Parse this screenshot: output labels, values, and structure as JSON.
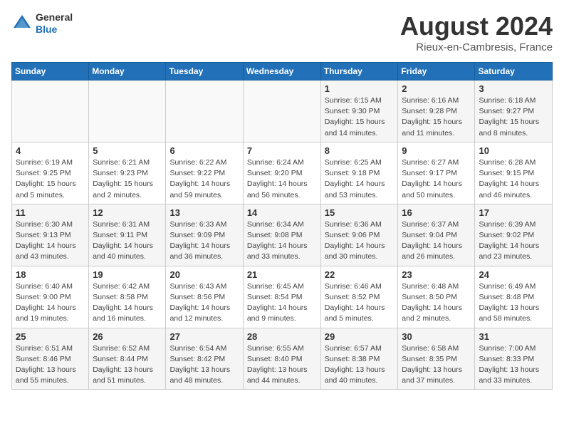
{
  "header": {
    "logo_general": "General",
    "logo_blue": "Blue",
    "month_year": "August 2024",
    "location": "Rieux-en-Cambresis, France"
  },
  "days_of_week": [
    "Sunday",
    "Monday",
    "Tuesday",
    "Wednesday",
    "Thursday",
    "Friday",
    "Saturday"
  ],
  "weeks": [
    [
      {
        "day": "",
        "info": ""
      },
      {
        "day": "",
        "info": ""
      },
      {
        "day": "",
        "info": ""
      },
      {
        "day": "",
        "info": ""
      },
      {
        "day": "1",
        "info": "Sunrise: 6:15 AM\nSunset: 9:30 PM\nDaylight: 15 hours\nand 14 minutes."
      },
      {
        "day": "2",
        "info": "Sunrise: 6:16 AM\nSunset: 9:28 PM\nDaylight: 15 hours\nand 11 minutes."
      },
      {
        "day": "3",
        "info": "Sunrise: 6:18 AM\nSunset: 9:27 PM\nDaylight: 15 hours\nand 8 minutes."
      }
    ],
    [
      {
        "day": "4",
        "info": "Sunrise: 6:19 AM\nSunset: 9:25 PM\nDaylight: 15 hours\nand 5 minutes."
      },
      {
        "day": "5",
        "info": "Sunrise: 6:21 AM\nSunset: 9:23 PM\nDaylight: 15 hours\nand 2 minutes."
      },
      {
        "day": "6",
        "info": "Sunrise: 6:22 AM\nSunset: 9:22 PM\nDaylight: 14 hours\nand 59 minutes."
      },
      {
        "day": "7",
        "info": "Sunrise: 6:24 AM\nSunset: 9:20 PM\nDaylight: 14 hours\nand 56 minutes."
      },
      {
        "day": "8",
        "info": "Sunrise: 6:25 AM\nSunset: 9:18 PM\nDaylight: 14 hours\nand 53 minutes."
      },
      {
        "day": "9",
        "info": "Sunrise: 6:27 AM\nSunset: 9:17 PM\nDaylight: 14 hours\nand 50 minutes."
      },
      {
        "day": "10",
        "info": "Sunrise: 6:28 AM\nSunset: 9:15 PM\nDaylight: 14 hours\nand 46 minutes."
      }
    ],
    [
      {
        "day": "11",
        "info": "Sunrise: 6:30 AM\nSunset: 9:13 PM\nDaylight: 14 hours\nand 43 minutes."
      },
      {
        "day": "12",
        "info": "Sunrise: 6:31 AM\nSunset: 9:11 PM\nDaylight: 14 hours\nand 40 minutes."
      },
      {
        "day": "13",
        "info": "Sunrise: 6:33 AM\nSunset: 9:09 PM\nDaylight: 14 hours\nand 36 minutes."
      },
      {
        "day": "14",
        "info": "Sunrise: 6:34 AM\nSunset: 9:08 PM\nDaylight: 14 hours\nand 33 minutes."
      },
      {
        "day": "15",
        "info": "Sunrise: 6:36 AM\nSunset: 9:06 PM\nDaylight: 14 hours\nand 30 minutes."
      },
      {
        "day": "16",
        "info": "Sunrise: 6:37 AM\nSunset: 9:04 PM\nDaylight: 14 hours\nand 26 minutes."
      },
      {
        "day": "17",
        "info": "Sunrise: 6:39 AM\nSunset: 9:02 PM\nDaylight: 14 hours\nand 23 minutes."
      }
    ],
    [
      {
        "day": "18",
        "info": "Sunrise: 6:40 AM\nSunset: 9:00 PM\nDaylight: 14 hours\nand 19 minutes."
      },
      {
        "day": "19",
        "info": "Sunrise: 6:42 AM\nSunset: 8:58 PM\nDaylight: 14 hours\nand 16 minutes."
      },
      {
        "day": "20",
        "info": "Sunrise: 6:43 AM\nSunset: 8:56 PM\nDaylight: 14 hours\nand 12 minutes."
      },
      {
        "day": "21",
        "info": "Sunrise: 6:45 AM\nSunset: 8:54 PM\nDaylight: 14 hours\nand 9 minutes."
      },
      {
        "day": "22",
        "info": "Sunrise: 6:46 AM\nSunset: 8:52 PM\nDaylight: 14 hours\nand 5 minutes."
      },
      {
        "day": "23",
        "info": "Sunrise: 6:48 AM\nSunset: 8:50 PM\nDaylight: 14 hours\nand 2 minutes."
      },
      {
        "day": "24",
        "info": "Sunrise: 6:49 AM\nSunset: 8:48 PM\nDaylight: 13 hours\nand 58 minutes."
      }
    ],
    [
      {
        "day": "25",
        "info": "Sunrise: 6:51 AM\nSunset: 8:46 PM\nDaylight: 13 hours\nand 55 minutes."
      },
      {
        "day": "26",
        "info": "Sunrise: 6:52 AM\nSunset: 8:44 PM\nDaylight: 13 hours\nand 51 minutes."
      },
      {
        "day": "27",
        "info": "Sunrise: 6:54 AM\nSunset: 8:42 PM\nDaylight: 13 hours\nand 48 minutes."
      },
      {
        "day": "28",
        "info": "Sunrise: 6:55 AM\nSunset: 8:40 PM\nDaylight: 13 hours\nand 44 minutes."
      },
      {
        "day": "29",
        "info": "Sunrise: 6:57 AM\nSunset: 8:38 PM\nDaylight: 13 hours\nand 40 minutes."
      },
      {
        "day": "30",
        "info": "Sunrise: 6:58 AM\nSunset: 8:35 PM\nDaylight: 13 hours\nand 37 minutes."
      },
      {
        "day": "31",
        "info": "Sunrise: 7:00 AM\nSunset: 8:33 PM\nDaylight: 13 hours\nand 33 minutes."
      }
    ]
  ]
}
